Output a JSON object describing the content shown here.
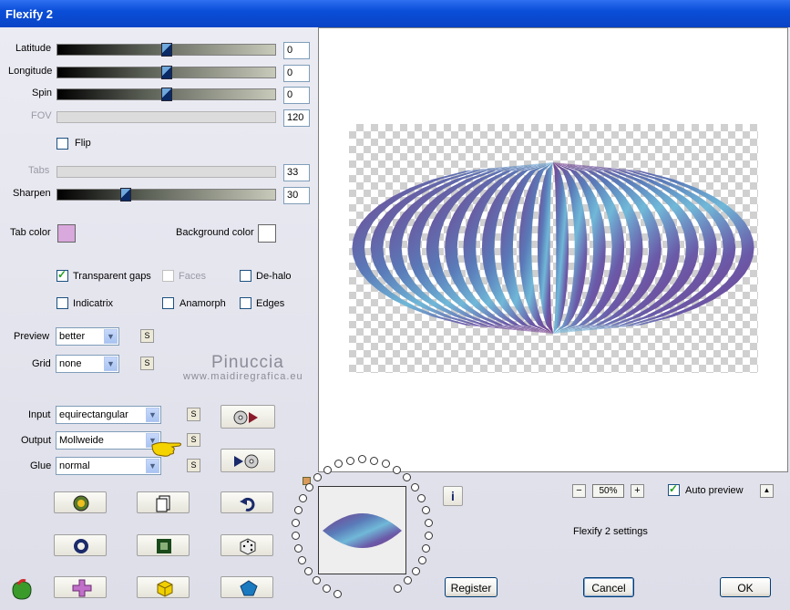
{
  "window": {
    "title": "Flexify 2"
  },
  "sliders": {
    "latitude": {
      "label": "Latitude",
      "value": "0",
      "fraction": 0.5
    },
    "longitude": {
      "label": "Longitude",
      "value": "0",
      "fraction": 0.5
    },
    "spin": {
      "label": "Spin",
      "value": "0",
      "fraction": 0.5
    },
    "fov": {
      "label": "FOV",
      "value": "120"
    },
    "tabs": {
      "label": "Tabs",
      "value": "33"
    },
    "sharpen": {
      "label": "Sharpen",
      "value": "30",
      "fraction": 0.3
    }
  },
  "flip": {
    "label": "Flip",
    "checked": false
  },
  "colors": {
    "tab_color_label": "Tab color",
    "tab_color": "#d9a8dc",
    "background_color_label": "Background color",
    "background_color": "#ffffff"
  },
  "options": {
    "transparent_gaps": {
      "label": "Transparent gaps",
      "checked": true
    },
    "faces": {
      "label": "Faces",
      "checked": false
    },
    "de_halo": {
      "label": "De-halo",
      "checked": false
    },
    "indicatrix": {
      "label": "Indicatrix",
      "checked": false
    },
    "anamorph": {
      "label": "Anamorph",
      "checked": false
    },
    "edges": {
      "label": "Edges",
      "checked": false
    }
  },
  "selects": {
    "preview": {
      "label": "Preview",
      "value": "better"
    },
    "grid": {
      "label": "Grid",
      "value": "none"
    },
    "input": {
      "label": "Input",
      "value": "equirectangular"
    },
    "output": {
      "label": "Output",
      "value": "Mollweide"
    },
    "glue": {
      "label": "Glue",
      "value": "normal"
    }
  },
  "s_button_label": "S",
  "watermark": {
    "name": "Pinuccia",
    "url": "www.maidiregrafica.eu"
  },
  "zoom": {
    "value": "50%",
    "minus": "−",
    "plus": "+"
  },
  "auto_preview": {
    "label": "Auto preview",
    "checked": true
  },
  "status_text": "Flexify 2 settings",
  "buttons": {
    "register": "Register",
    "cancel": "Cancel",
    "ok": "OK",
    "info": "i",
    "collapse": "▲"
  },
  "icons": [
    "settings-wheel-icon",
    "page-icon",
    "undo-icon",
    "ring-icon",
    "square-frame-icon",
    "dice-icon",
    "plus-shape-icon",
    "cube-icon",
    "pentagon-icon"
  ]
}
